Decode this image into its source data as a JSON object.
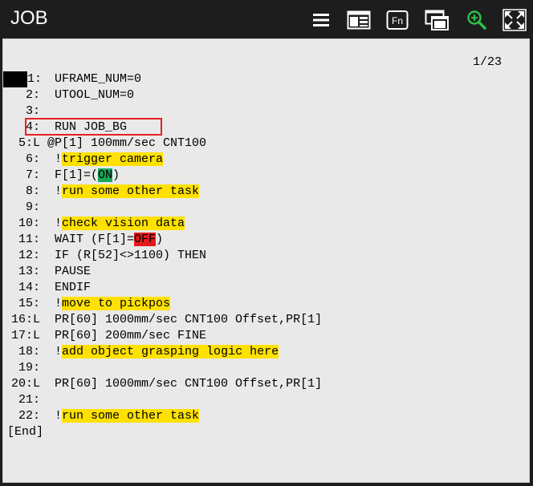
{
  "window": {
    "title": "JOB"
  },
  "toolbar": {
    "icons": [
      {
        "name": "menu-icon"
      },
      {
        "name": "split-screen-icon"
      },
      {
        "name": "fn-icon",
        "label": "Fn"
      },
      {
        "name": "window-select-icon"
      },
      {
        "name": "zoom-in-icon"
      },
      {
        "name": "maximize-icon"
      }
    ]
  },
  "editor": {
    "pager": "1/23",
    "end_marker": "[End]",
    "lines": [
      {
        "num": "1:",
        "prefix": "  ",
        "segments": [
          {
            "t": "UFRAME_NUM=0"
          }
        ]
      },
      {
        "num": "2:",
        "prefix": "  ",
        "segments": [
          {
            "t": "UTOOL_NUM=0"
          }
        ]
      },
      {
        "num": "3:",
        "prefix": "  ",
        "segments": []
      },
      {
        "num": "4:",
        "prefix": "  ",
        "segments": [
          {
            "t": "RUN JOB_BG"
          }
        ]
      },
      {
        "num": "5:L",
        "prefix": " ",
        "segments": [
          {
            "t": "@P[1] 100mm/sec CNT100"
          }
        ]
      },
      {
        "num": "6:",
        "prefix": "  ",
        "segments": [
          {
            "t": "!"
          },
          {
            "t": "trigger camera",
            "hl": "y"
          }
        ]
      },
      {
        "num": "7:",
        "prefix": "  ",
        "segments": [
          {
            "t": "F[1]=("
          },
          {
            "t": "ON",
            "hl": "g"
          },
          {
            "t": ")"
          }
        ]
      },
      {
        "num": "8:",
        "prefix": "  ",
        "segments": [
          {
            "t": "!"
          },
          {
            "t": "run some other task",
            "hl": "y"
          }
        ]
      },
      {
        "num": "9:",
        "prefix": "  ",
        "segments": []
      },
      {
        "num": "10:",
        "prefix": "  ",
        "segments": [
          {
            "t": "!"
          },
          {
            "t": "check vision data",
            "hl": "y"
          }
        ]
      },
      {
        "num": "11:",
        "prefix": "  ",
        "segments": [
          {
            "t": "WAIT (F[1]="
          },
          {
            "t": "OFF",
            "hl": "r"
          },
          {
            "t": ")"
          }
        ]
      },
      {
        "num": "12:",
        "prefix": "  ",
        "segments": [
          {
            "t": "IF (R[52]<>1100) THEN"
          }
        ]
      },
      {
        "num": "13:",
        "prefix": "  ",
        "segments": [
          {
            "t": "PAUSE"
          }
        ]
      },
      {
        "num": "14:",
        "prefix": "  ",
        "segments": [
          {
            "t": "ENDIF"
          }
        ]
      },
      {
        "num": "15:",
        "prefix": "  ",
        "segments": [
          {
            "t": "!"
          },
          {
            "t": "move to pickpos",
            "hl": "y"
          }
        ]
      },
      {
        "num": "16:L",
        "prefix": "  ",
        "segments": [
          {
            "t": "PR[60] 1000mm/sec CNT100 Offset,PR[1]"
          }
        ]
      },
      {
        "num": "17:L",
        "prefix": "  ",
        "segments": [
          {
            "t": "PR[60] 200mm/sec FINE"
          }
        ]
      },
      {
        "num": "18:",
        "prefix": "  ",
        "segments": [
          {
            "t": "!"
          },
          {
            "t": "add object grasping logic here",
            "hl": "y"
          }
        ]
      },
      {
        "num": "19:",
        "prefix": "  ",
        "segments": []
      },
      {
        "num": "20:L",
        "prefix": "  ",
        "segments": [
          {
            "t": "PR[60] 1000mm/sec CNT100 Offset,PR[1]"
          }
        ]
      },
      {
        "num": "21:",
        "prefix": "  ",
        "segments": []
      },
      {
        "num": "22:",
        "prefix": "  ",
        "segments": [
          {
            "t": "!"
          },
          {
            "t": "run some other task",
            "hl": "y"
          }
        ]
      }
    ]
  },
  "colors": {
    "highlight_yellow": "#ffe100",
    "highlight_green": "#18a85a",
    "highlight_red": "#e41b1b",
    "annotation_box": "#e52025"
  }
}
